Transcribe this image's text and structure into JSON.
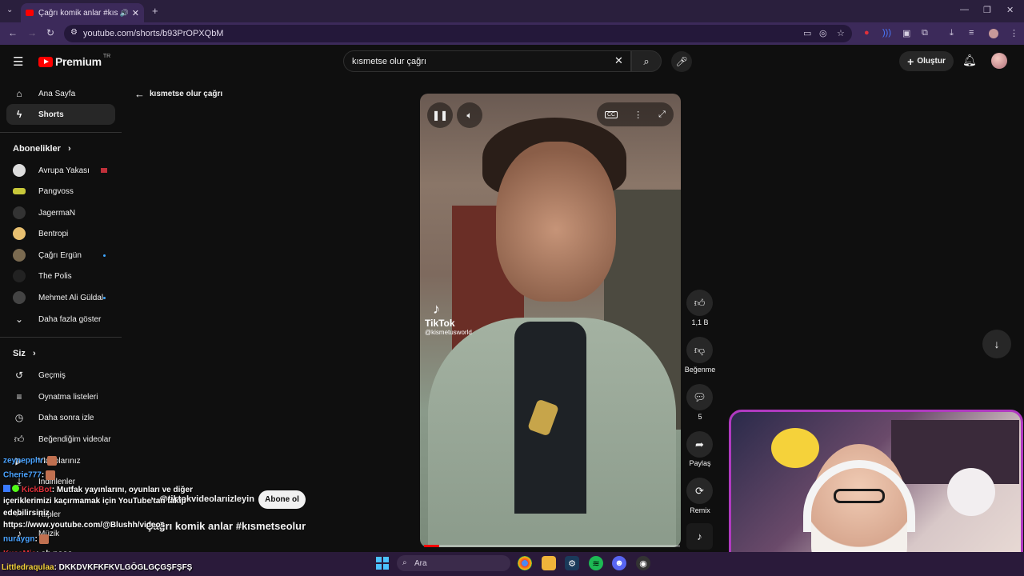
{
  "browser": {
    "tab_title": "Çağrı komik anlar #kısmets",
    "url": "youtube.com/shorts/b93PrOPXQbM",
    "min": "—",
    "restore": "❐",
    "close": "✕"
  },
  "header": {
    "logo_text": "Premium",
    "logo_country": "TR",
    "search_query": "kısmetse olur çağrı",
    "create_label": "Oluştur"
  },
  "sidebar": {
    "main": [
      {
        "label": "Ana Sayfa",
        "icon": "home-icon"
      },
      {
        "label": "Shorts",
        "icon": "shorts-icon"
      }
    ],
    "subs_title": "Abonelikler",
    "subs": [
      {
        "label": "Avrupa Yakası"
      },
      {
        "label": "Pangvoss"
      },
      {
        "label": "JagermaN"
      },
      {
        "label": "Bentropi"
      },
      {
        "label": "Çağrı Ergün"
      },
      {
        "label": "The Polis"
      },
      {
        "label": "Mehmet Ali Güldal"
      }
    ],
    "show_more": "Daha fazla göster",
    "you_title": "Siz",
    "you": [
      {
        "label": "Geçmiş"
      },
      {
        "label": "Oynatma listeleri"
      },
      {
        "label": "Daha sonra izle"
      },
      {
        "label": "Beğendiğim videolar"
      },
      {
        "label": "Videolarınız"
      },
      {
        "label": "İndirilenler"
      },
      {
        "label": "Klipler"
      },
      {
        "label": "Müzik"
      }
    ]
  },
  "main": {
    "back_label": "kısmetse olur çağrı",
    "tiktok_brand": "TikTok",
    "tiktok_handle": "@kismetusworld",
    "progress": 0.06,
    "channel": "@tiktokvideolarıizleyin",
    "subscribe": "Abone ol",
    "title": "Çağrı komik anlar #kısmetseolur"
  },
  "actions": {
    "likes": "1,1 B",
    "dislike": "Beğenme",
    "comments": "5",
    "share": "Paylaş",
    "remix": "Remix"
  },
  "chat": [
    {
      "user": "zeynepphr",
      "text": ":"
    },
    {
      "user": "Cherie777",
      "text": ":"
    },
    {
      "user": "KickBot",
      "text": ": Mutfak yayınlarını, oyunları ve diğer"
    },
    {
      "text": "içeriklerimizi kaçırmamak için YouTube'tan takip"
    },
    {
      "text": "edebilirsiniz"
    },
    {
      "text": "https://www.youtube.com/@Blushh/videos"
    },
    {
      "user": "nuraygn",
      "text": ":"
    },
    {
      "user": "KusaMia",
      "text": ": oh nooo"
    },
    {
      "user": "Littledraqulaa",
      "text": ": DKKDVKFKFKVLGÖGLGÇGŞFŞFŞ"
    }
  ],
  "taskbar": {
    "search_placeholder": "Ara"
  }
}
